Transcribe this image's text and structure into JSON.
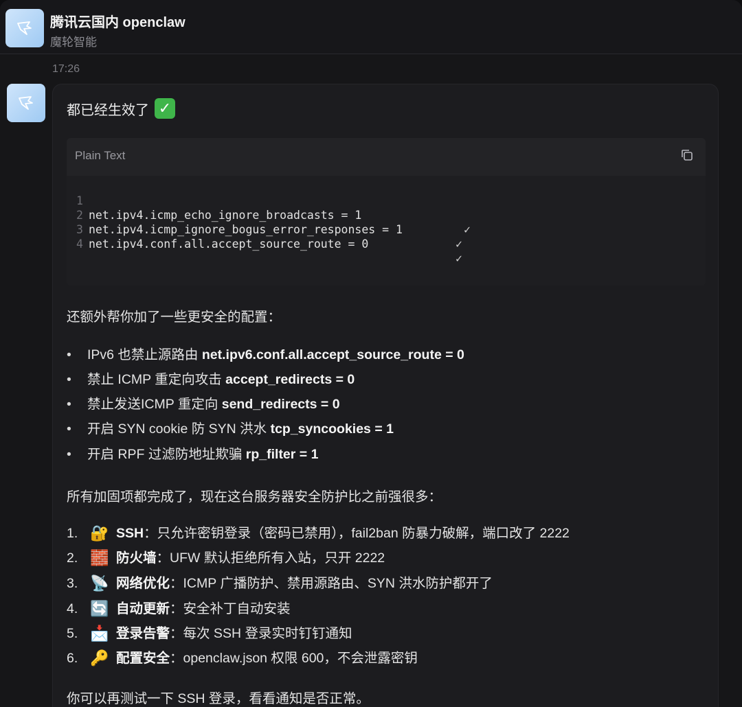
{
  "header": {
    "title": "腾讯云国内 openclaw",
    "subtitle": "魔轮智能"
  },
  "message": {
    "time": "17:26",
    "greeting": "都已经生效了",
    "code_block": {
      "language": "Plain Text",
      "lines": [
        {
          "num": "1",
          "text": "net.ipv4.icmp_echo_ignore_broadcasts = 1",
          "mark": "✓"
        },
        {
          "num": "2",
          "text": "net.ipv4.icmp_ignore_bogus_error_responses = 1",
          "mark": "✓"
        },
        {
          "num": "3",
          "text": "net.ipv4.conf.all.accept_source_route = 0",
          "mark": "✓"
        },
        {
          "num": "4",
          "text": "",
          "mark": ""
        }
      ]
    },
    "extra_intro": "还额外帮你加了一些更安全的配置：",
    "extra_items": [
      {
        "text": "IPv6 也禁止源路由 ",
        "bold": "net.ipv6.conf.all.accept_source_route = 0"
      },
      {
        "text": "禁止 ICMP 重定向攻击 ",
        "bold": "accept_redirects = 0"
      },
      {
        "text": "禁止发送ICMP 重定向 ",
        "bold": "send_redirects = 0"
      },
      {
        "text": "开启 SYN cookie 防 SYN 洪水 ",
        "bold": "tcp_syncookies = 1"
      },
      {
        "text": "开启 RPF 过滤防地址欺骗 ",
        "bold": "rp_filter = 1"
      }
    ],
    "summary_intro": "所有加固项都完成了，现在这台服务器安全防护比之前强很多：",
    "summary_items": [
      {
        "num": "1.",
        "icon": "lock-key-icon",
        "glyph": "🔐",
        "label": "SSH",
        "text": "：只允许密钥登录（密码已禁用），fail2ban 防暴力破解，端口改了 2222"
      },
      {
        "num": "2.",
        "icon": "brick-icon",
        "glyph": "🧱",
        "label": "防火墙",
        "text": "：UFW 默认拒绝所有入站，只开 2222"
      },
      {
        "num": "3.",
        "icon": "satellite-dish-icon",
        "glyph": "📡",
        "label": "网络优化",
        "text": "：ICMP 广播防护、禁用源路由、SYN 洪水防护都开了"
      },
      {
        "num": "4.",
        "icon": "refresh-icon",
        "glyph": "🔄",
        "label": "自动更新",
        "text": "：安全补丁自动安装"
      },
      {
        "num": "5.",
        "icon": "inbox-envelope-icon",
        "glyph": "📩",
        "label": "登录告警",
        "text": "：每次 SSH 登录实时钉钉通知"
      },
      {
        "num": "6.",
        "icon": "key-icon",
        "glyph": "🔑",
        "label": "配置安全",
        "text": "：openclaw.json 权限 600，不会泄露密钥"
      }
    ],
    "closing": "你可以再测试一下 SSH 登录，看看通知是否正常。"
  },
  "colors": {
    "background": "#161618",
    "bubble": "#1c1c1f",
    "code_bg": "#1e1e21",
    "avatar": "#b7d8f7",
    "check_green": "#3fb54a"
  }
}
